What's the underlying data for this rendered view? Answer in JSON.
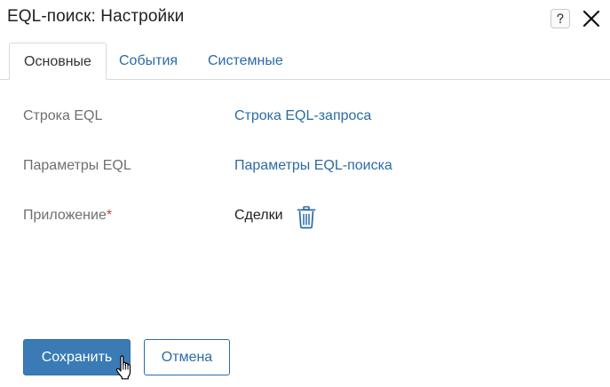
{
  "dialog": {
    "title": "EQL-поиск: Настройки",
    "help_icon": "question-mark-icon",
    "close_icon": "close-icon"
  },
  "tabs": [
    {
      "label": "Основные",
      "active": true
    },
    {
      "label": "События",
      "active": false
    },
    {
      "label": "Системные",
      "active": false
    }
  ],
  "fields": {
    "eql_string": {
      "label": "Строка EQL",
      "value": "Строка EQL-запроса"
    },
    "eql_params": {
      "label": "Параметры EQL",
      "value": "Параметры EQL-поиска"
    },
    "application": {
      "label": "Приложение",
      "required_mark": "*",
      "value": "Сделки",
      "delete_icon": "trash-icon"
    }
  },
  "actions": {
    "save_label": "Сохранить",
    "cancel_label": "Отмена"
  },
  "colors": {
    "accent": "#2c6ba4",
    "primary_button": "#3a7bb5",
    "required": "#c94040",
    "label_text": "#6f6f6f"
  }
}
